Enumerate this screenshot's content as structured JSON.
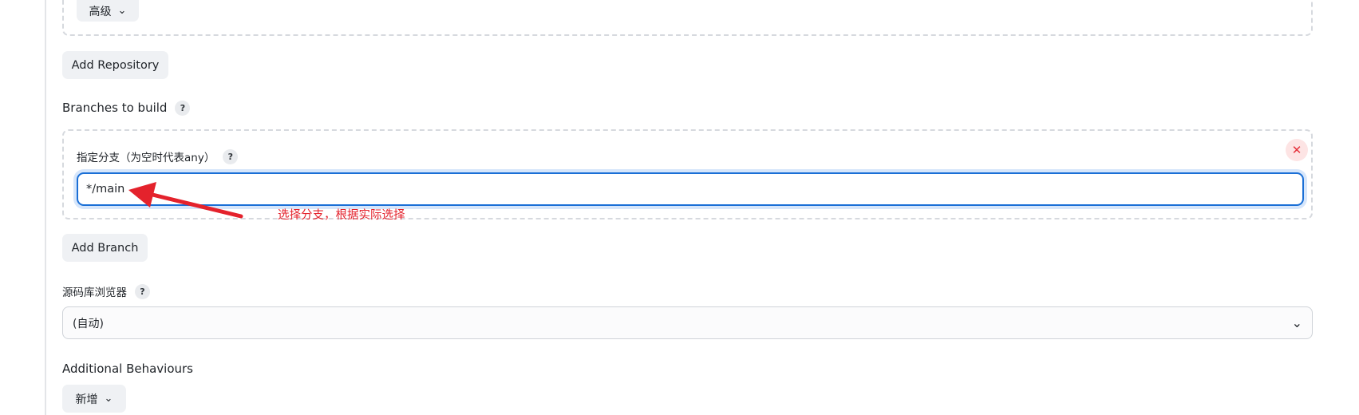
{
  "repository": {
    "advanced_label": "高级",
    "add_repository_label": "Add Repository"
  },
  "branches": {
    "section_label": "Branches to build",
    "help_label": "?",
    "specifier_label": "指定分支（为空时代表any）",
    "specifier_help": "?",
    "specifier_value": "*/main",
    "remove_label": "✕",
    "add_branch_label": "Add Branch"
  },
  "annotation": {
    "text": "选择分支，根据实际选择",
    "color": "#e4222c"
  },
  "repository_browser": {
    "label": "源码库浏览器",
    "help_label": "?",
    "selected_value": "(自动)"
  },
  "additional_behaviours": {
    "label": "Additional Behaviours",
    "add_label": "新增"
  },
  "colors": {
    "focus_border": "#1a6fd6",
    "button_bg": "#eff1f4",
    "danger": "#e5303a"
  }
}
